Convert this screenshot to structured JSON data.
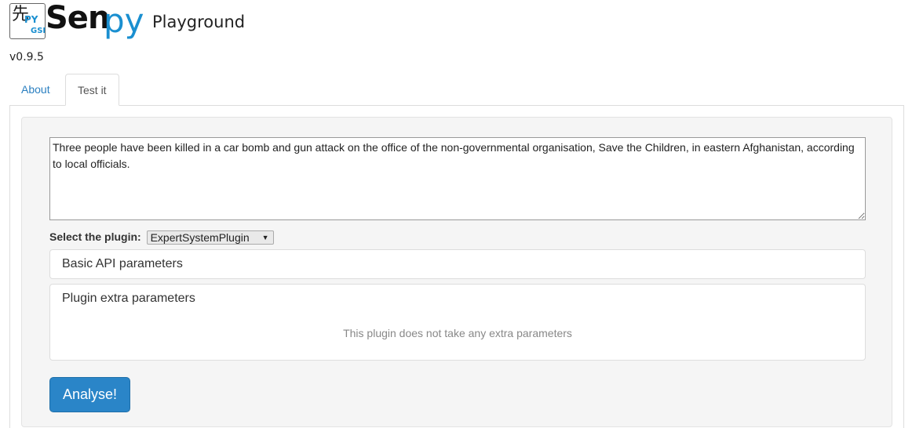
{
  "header": {
    "logo_kanji": "先",
    "logo_py": "PY",
    "logo_gsi": "GSI",
    "brand_sen": "Sen",
    "brand_py": "py",
    "brand_subtitle": "Playground",
    "version": "v0.9.5"
  },
  "tabs": [
    {
      "label": "About",
      "active": false
    },
    {
      "label": "Test it",
      "active": true
    }
  ],
  "form": {
    "input_text": "Three people have been killed in a car bomb and gun attack on the office of the non-governmental organisation, Save the Children, in eastern Afghanistan, according to local officials.",
    "plugin_label": "Select the plugin:",
    "plugin_selected": "ExpertSystemPlugin",
    "basic_panel_title": "Basic API parameters",
    "extra_panel_title": "Plugin extra parameters",
    "extra_panel_note": "This plugin does not take any extra parameters",
    "analyse_button": "Analyse!"
  },
  "colors": {
    "accent": "#1a8fd0",
    "button": "#2a85c8",
    "link": "#2a7fc0",
    "well": "#f5f5f5"
  },
  "icons": {
    "select_arrow": "chevron-down-icon",
    "textarea_resize": "resize-grip-icon"
  }
}
